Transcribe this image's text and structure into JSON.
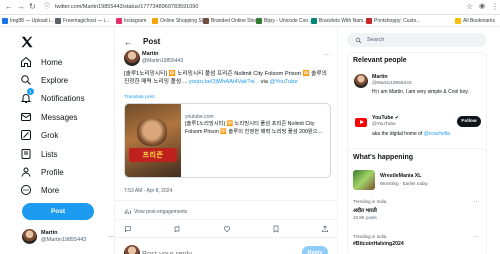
{
  "browser": {
    "url": "twitter.com/Martin19855443/status/1777348969783591090",
    "bookmarks": [
      "Img88 — Upload i...",
      "Freemagichost — i...",
      "Instagram",
      "Online Shopping Sit...",
      "Branded Online Sho...",
      "Bijoy - Unicode Con...",
      "Bracelets With Nam...",
      "Printshoppy: Custo..."
    ],
    "all_bookmarks": "All Bookmarks"
  },
  "nav": {
    "items": [
      "Home",
      "Explore",
      "Notifications",
      "Messages",
      "Grok",
      "Lists",
      "Profile",
      "More"
    ],
    "notification_badge": "1",
    "post_button": "Post",
    "account": {
      "name": "Martin",
      "handle": "@Martin19855443"
    }
  },
  "post": {
    "header_title": "Post",
    "author_name": "Martin",
    "author_handle": "@Martin19855443",
    "text_main": "[솔루1노리밍시티] 🈸 노리밍시티 풀섬 프리즌 Nolimit City Folsom Prison 🈸 솔루의 진정한 매력 노리밍 폴섬 ...",
    "text_link": "youtu.be/2jWhAAt4Vak?si...",
    "text_via": " via",
    "text_mention": "@YouTube",
    "translate": "Translate post",
    "card_domain": "youtube.com",
    "card_title": "[솔루1노리밍시티] 🈸 노리밍시티 풀섬 프리즌 Nolimit City Folsom Prison 🈸 솔루의 진정한 매력 노리밍 폴섬 200원으...",
    "card_banner": "프리즌",
    "timestamp": "7:53 AM · Apr 8, 2024",
    "view_engagements": "View post engagements",
    "reply_placeholder": "Post your reply",
    "reply_button": "Reply"
  },
  "sidebar": {
    "search_placeholder": "Search",
    "relevant_title": "Relevant people",
    "people": [
      {
        "name": "Martin",
        "handle": "@Martin19855443",
        "bio": "Hi i am Martin. I am very simple & Cool boy."
      },
      {
        "name": "YouTube ✔",
        "handle": "@YouTube",
        "bio_prefix": "aka the digital home of ",
        "bio_link": "@coachella",
        "follow": "Follow"
      }
    ],
    "happening_title": "What's happening",
    "trends": [
      {
        "name": "WrestleMania XL",
        "meta": "Wrestling · Earlier today"
      },
      {
        "context": "Trending in India",
        "name": "अदीत भारती",
        "meta": "10.8K posts"
      },
      {
        "context": "Trending in India",
        "name": "#BitcoinHalving2024",
        "meta": ""
      }
    ]
  },
  "colors": {
    "accent": "#1d9bf0",
    "text": "#0f1419",
    "muted": "#536471",
    "border": "#eff3f4"
  }
}
